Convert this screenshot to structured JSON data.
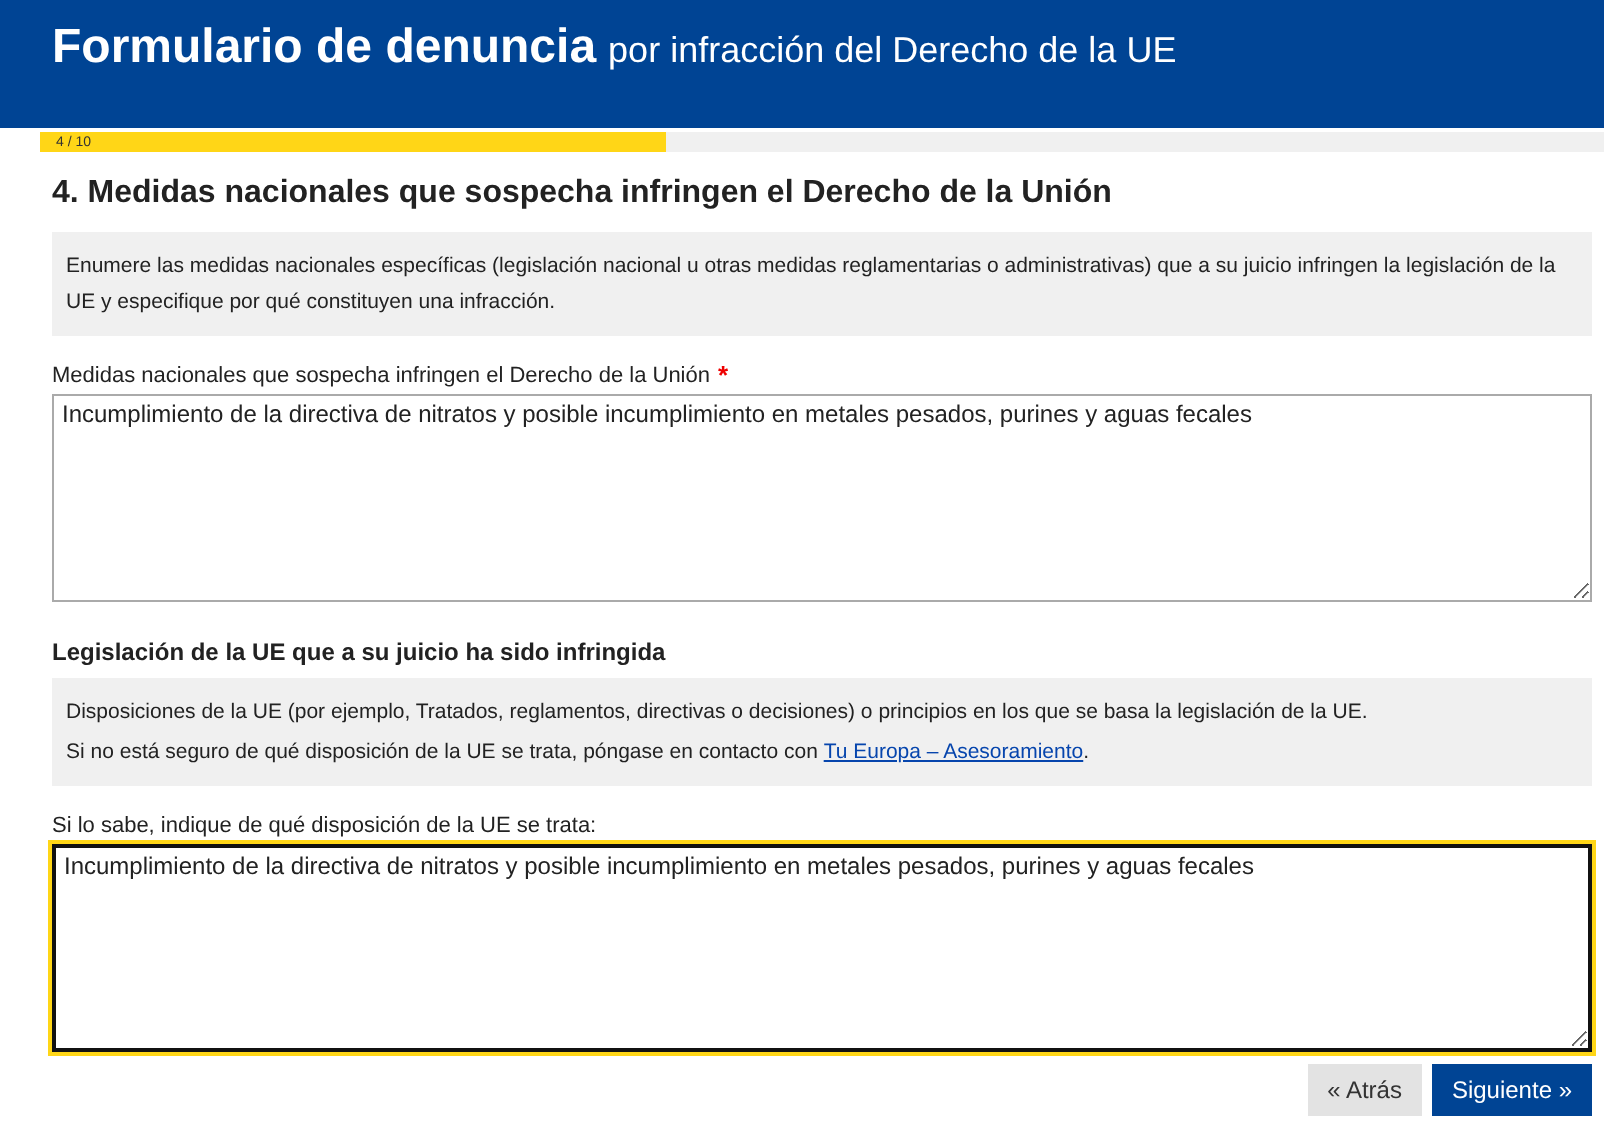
{
  "header": {
    "title": "Formulario de denuncia",
    "subtitle": "por infracción del Derecho de la UE"
  },
  "progress": {
    "label": "4 / 10",
    "level": 0.4
  },
  "section_title": "4. Medidas nacionales que sospecha infringen el Derecho de la Unión",
  "blocks": [
    {
      "kind": "info",
      "paragraphs": [
        "Enumere las medidas nacionales específicas (legislación nacional u otras medidas reglamentarias o administrativas) que a su juicio infringen la legislación de la UE y especifique por qué constituyen una infracción."
      ]
    },
    {
      "kind": "field",
      "label": "Medidas nacionales que sospecha infringen el Derecho de la Unión",
      "required_mark": "*",
      "value": "Incumplimiento de la directiva de nitratos y posible incumplimiento en metales pesados, purines y aguas fecales",
      "focused": false
    },
    {
      "kind": "heading",
      "text": "Legislación de la UE que a su juicio ha sido infringida"
    },
    {
      "kind": "info",
      "paragraphs": [
        "Disposiciones de la UE (por ejemplo, Tratados, reglamentos, directivas o decisiones) o principios en los que se basa la legislación de la UE.",
        "Si no está seguro de qué disposición de la UE se trata, póngase en contacto con"
      ],
      "link": "Tu Europa – Asesoramiento",
      "link_after": "."
    },
    {
      "kind": "field",
      "label": "Si lo sabe, indique de qué disposición de la UE se trata:",
      "value": "Incumplimiento de la directiva de nitratos y posible incumplimiento en metales pesados, purines y aguas fecales",
      "focused": true
    }
  ],
  "buttons": [
    {
      "label": "« Atrás",
      "kind": "secondary"
    },
    {
      "label": "Siguiente »",
      "kind": "primary"
    }
  ]
}
